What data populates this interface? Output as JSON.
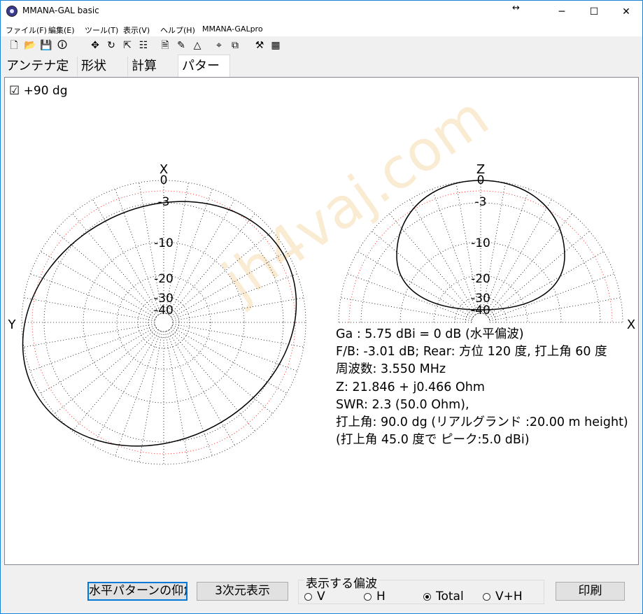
{
  "window": {
    "title": "MMANA-GAL basic",
    "resize_glyph": "↔",
    "minimize_glyph": "─",
    "maximize_glyph": "☐",
    "close_glyph": "✕"
  },
  "menu": [
    "ファイル(F)",
    "編集(E)",
    "ツール(T)",
    "表示(V)",
    "ヘルプ(H)",
    "MMANA-GALpro"
  ],
  "toolbar": {
    "icons": [
      "new-file-icon",
      "open-folder-icon",
      "save-icon",
      "info-icon",
      "move-icon",
      "rotate-icon",
      "stretch-icon",
      "segment-icon",
      "document-icon",
      "edit-icon",
      "triangle-icon",
      "target-icon",
      "copy-icon",
      "tools-icon",
      "calculator-icon"
    ],
    "glyphs": [
      "🗋",
      "📂",
      "💾",
      "🛈",
      "✥",
      "↻",
      "⇱",
      "☷",
      "🗎",
      "✎",
      "△",
      "⌖",
      "⧉",
      "⚒",
      "▦"
    ]
  },
  "tabs": [
    {
      "label": "アンテナ定義",
      "active": false
    },
    {
      "label": "形状",
      "active": false
    },
    {
      "label": "計算",
      "active": false
    },
    {
      "label": "パターン",
      "active": true
    }
  ],
  "pattern": {
    "checkbox_glyph": "☑",
    "elevation_label": "+90 dg",
    "left_top_axis": "X",
    "left_side_axis": "Y",
    "right_top_axis": "Z",
    "right_side_axis": "X",
    "ring_labels": [
      "0",
      "-3",
      "-10",
      "-20",
      "-30",
      "-40"
    ],
    "accent_colors": {
      "trace": "#000000",
      "minus3_ring": "#ff0000",
      "grid": "#000000"
    }
  },
  "info": {
    "lines": [
      "Ga : 5.75 dBi = 0 dB  (水平偏波)",
      "F/B: -3.01 dB; Rear: 方位 120 度,  打上角 60 度",
      "周波数: 3.550 MHz",
      "Z: 21.846 + j0.466 Ohm",
      "SWR: 2.3 (50.0 Ohm),",
      "打上角: 90.0 dg (リアルグランド  :20.00 m height)",
      "(打上角 45.0 度で ピーク:5.0 dBi)"
    ]
  },
  "bottom": {
    "elevation_button": "水平パターンの仰角",
    "view3d_button": "3次元表示",
    "polarization_title": "表示する偏波",
    "radios": [
      {
        "label": "V",
        "checked": false
      },
      {
        "label": "H",
        "checked": false
      },
      {
        "label": "Total",
        "checked": true
      },
      {
        "label": "V+H",
        "checked": false
      }
    ],
    "print_button": "印刷"
  }
}
